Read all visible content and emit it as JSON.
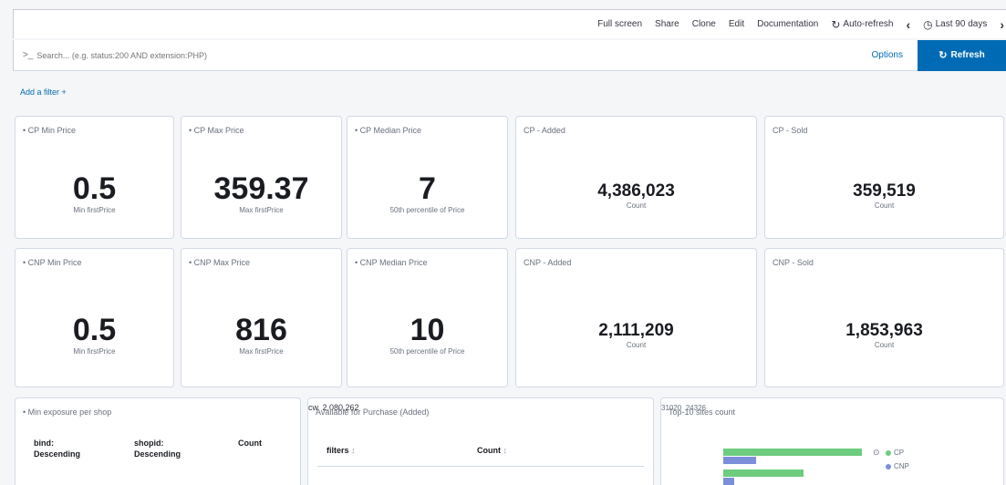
{
  "nav": {
    "full_screen": "Full screen",
    "share": "Share",
    "clone": "Clone",
    "edit": "Edit",
    "documentation": "Documentation",
    "auto_refresh": "Auto-refresh",
    "time_range": "Last 90 days"
  },
  "query": {
    "prompt": ">_",
    "placeholder": "Search... (e.g. status:200 AND extension:PHP)",
    "options": "Options",
    "refresh": "Refresh"
  },
  "filters": {
    "add_filter": "Add a filter +"
  },
  "row1": [
    {
      "title": "• CP Min Price",
      "value": "0.5",
      "label": "Min firstPrice"
    },
    {
      "title": "• CP Max Price",
      "value": "359.37",
      "label": "Max firstPrice"
    },
    {
      "title": "• CP Median Price",
      "value": "7",
      "label": "50th percentile of Price"
    },
    {
      "title": "CP - Added",
      "value": "4,386,023",
      "label": "Count"
    },
    {
      "title": "CP - Sold",
      "value": "359,519",
      "label": "Count"
    }
  ],
  "row2": [
    {
      "title": "• CNP Min Price",
      "value": "0.5",
      "label": "Min firstPrice"
    },
    {
      "title": "• CNP Max Price",
      "value": "816",
      "label": "Max firstPrice"
    },
    {
      "title": "• CNP Median Price",
      "value": "10",
      "label": "50th percentile of Price"
    },
    {
      "title": "CNP - Added",
      "value": "2,111,209",
      "label": "Count"
    },
    {
      "title": "CNP - Sold",
      "value": "1,853,963",
      "label": "Count"
    }
  ],
  "bottom": {
    "exposure": {
      "title": "• Min exposure per shop",
      "columns": [
        {
          "name": "bind:",
          "sort": "Descending"
        },
        {
          "name": "shopid:",
          "sort": "Descending"
        },
        {
          "name": "Count",
          "sort": ""
        }
      ]
    },
    "available": {
      "title": "Available for Purchase (Added)",
      "columns": [
        "filters",
        "Count"
      ],
      "rows": [
        {
          "filter": "cw",
          "count": "2,080,262"
        }
      ]
    },
    "top10": {
      "title": "Top-10 sites count",
      "ticks": [
        "31020",
        "24326"
      ],
      "legend": [
        {
          "name": "CP",
          "color": "#6dcc7e"
        },
        {
          "name": "CNP",
          "color": "#7b8fdb"
        }
      ]
    }
  }
}
